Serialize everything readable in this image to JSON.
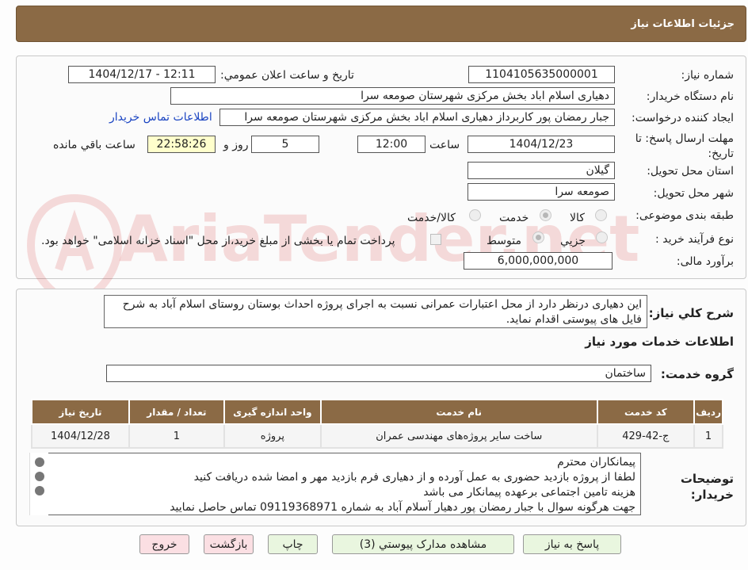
{
  "header": {
    "title": "جزئیات اطلاعات نیاز"
  },
  "form": {
    "need_number_label": "شماره نیاز:",
    "need_number": "1104105635000001",
    "announce_label": "تاریخ و ساعت اعلان عمومي:",
    "announce_value": "1404/12/17 - 12:11",
    "buyer_label": "نام دستگاه خريدار:",
    "buyer_value": "دهیاری اسلام اباد بخش مرکزی شهرستان صومعه سرا",
    "creator_label": "ايجاد کننده درخواست:",
    "creator_value": "جبار رمضان پور کاربرداز دهیاری اسلام اباد بخش مرکزی شهرستان صومعه سرا",
    "contact_link": "اطلاعات تماس خريدار",
    "deadline_label": "مهلت ارسال پاسخ: تا تاريخ:",
    "deadline_date": "1404/12/23",
    "time_label": "ساعت",
    "deadline_time": "12:00",
    "days_value": "5",
    "days_label": "روز و",
    "remaining_time": "22:58:26",
    "remaining_label": "ساعت باقي مانده",
    "province_label": "استان محل تحويل:",
    "province_value": "گيلان",
    "city_label": "شهر محل تحويل:",
    "city_value": "صومعه سرا",
    "category_label": "طبقه بندی موضوعی:",
    "category_options": [
      "کالا",
      "خدمت",
      "کالا/خدمت"
    ],
    "process_label": "نوع فرآيند خريد :",
    "process_options": [
      "جزيي",
      "متوسط"
    ],
    "payment_text": "پرداخت تمام يا بخشی از مبلغ خريد،از محل \"اسناد خزانه اسلامی\" خواهد بود.",
    "budget_label": "برآورد مالی:",
    "budget_value": "6,000,000,000"
  },
  "summary": {
    "label": "شرح كلي نياز:",
    "text": "این دهیاری درنظر دارد از محل اعتبارات عمرانی نسبت به اجرای پروژه احداث بوستان روستای اسلام آباد به شرح فایل های پیوستی اقدام نماید."
  },
  "services": {
    "section_title": "اطلاعات خدمات مورد نياز",
    "group_label": "گروه خدمت:",
    "group_value": "ساختمان",
    "columns": [
      "رديف",
      "کد خدمت",
      "نام خدمت",
      "واحد اندازه گيری",
      "تعداد / مقدار",
      "تاريخ نياز"
    ],
    "rows": [
      [
        "1",
        "ج-42-429",
        "ساخت سایر پروژه‌های مهندسی عمران",
        "پروژه",
        "1",
        "1404/12/28"
      ]
    ]
  },
  "notes": {
    "label": "توضيحات خريدار:",
    "lines": [
      "پیمانکاران محترم",
      "لطفا از پروژه بازدید حضوری به عمل آورده و از دهیاری فرم بازدید مهر و امضا شده دریافت کنید",
      "هزینه تامین اجتماعی برعهده پیمانکار می باشد",
      "جهت هرگونه سوال با جبار رمضان پور دهیار آسلام آباد به شماره 09119368971 تماس حاصل نمایید"
    ]
  },
  "buttons": {
    "reply": "پاسخ به نياز",
    "attachments": "مشاهده مدارک پيوستي (3)",
    "print": "چاپ",
    "back": "بازگشت",
    "exit": "خروج"
  },
  "watermark": {
    "text": "AriaTender.net"
  },
  "colors": {
    "header": "#8b6a45",
    "button": "#e9f6df",
    "button_alt": "#fbdfe3",
    "link": "#1a44c2"
  }
}
